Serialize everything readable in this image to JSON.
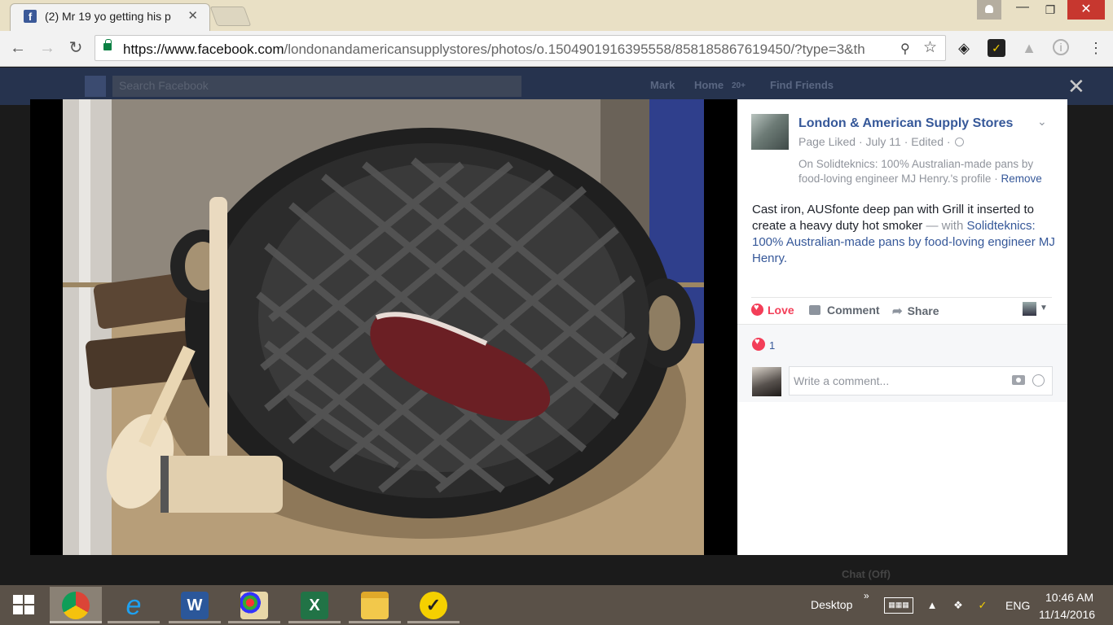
{
  "browser": {
    "tab_title": "(2) Mr 19 yo getting his p",
    "tab_close": "✕",
    "url_host": "https://www.facebook.com",
    "url_path": "/londonandamericansupplystores/photos/o.1504901916395558/858185867619450/?type=3&th",
    "window_min": "—",
    "window_max": "❐",
    "window_close": "✕"
  },
  "fb_header": {
    "search_placeholder": "Search Facebook",
    "user_name": "Mark",
    "home_label": "Home",
    "home_count": "20+",
    "find_friends_label": "Find Friends",
    "close_glyph": "✕"
  },
  "post": {
    "page_name": "London & American Supply Stores",
    "page_liked": "Page Liked",
    "date": "July 11",
    "edited": "Edited",
    "on_text": "On Solidteknics: 100% Australian-made pans by food-loving engineer MJ Henry.'s profile",
    "remove_label": "Remove",
    "text": "Cast iron, AUSfonte deep pan with Grill it inserted to create a heavy duty hot smoker",
    "with_label": "— with",
    "tagged": "Solidteknics: 100% Australian-made pans by food-loving engineer MJ Henry.",
    "love_label": "Love",
    "comment_label": "Comment",
    "share_label": "Share",
    "reaction_count": "1",
    "comment_placeholder": "Write a comment..."
  },
  "chat": {
    "label": "Chat (Off)"
  },
  "taskbar": {
    "desktop_label": "Desktop",
    "time": "10:46 AM",
    "date": "11/14/2016",
    "language": "ENG",
    "apps": [
      "chrome",
      "internet-explorer",
      "word",
      "paint",
      "excel",
      "file-explorer",
      "norton"
    ]
  },
  "colors": {
    "facebook_blue": "#365899",
    "love_red": "#f33e58",
    "taskbar": "#5a5148",
    "titlebar": "#e9e0c5"
  }
}
